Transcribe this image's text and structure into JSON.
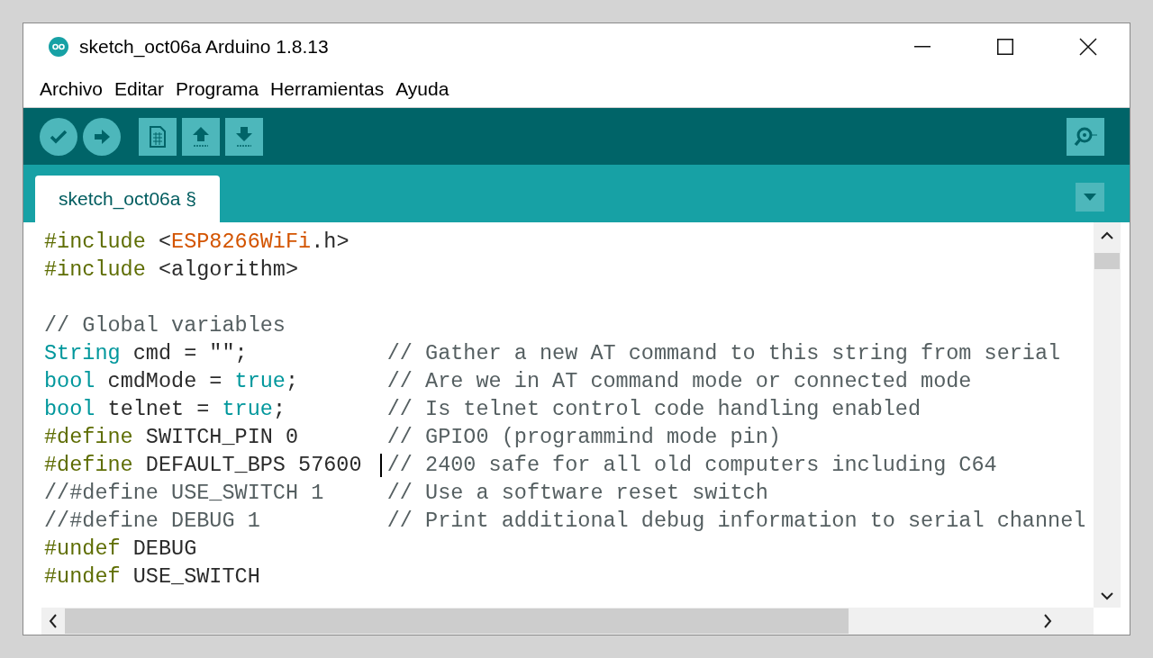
{
  "window": {
    "title": "sketch_oct06a Arduino 1.8.13"
  },
  "menu": [
    "Archivo",
    "Editar",
    "Programa",
    "Herramientas",
    "Ayuda"
  ],
  "tabs": [
    {
      "label": "sketch_oct06a §",
      "selected": true
    }
  ],
  "code_lines": [
    {
      "tokens": [
        {
          "kind": "directive",
          "text": "#include"
        },
        {
          "kind": "plain",
          "text": " <"
        },
        {
          "kind": "library",
          "text": "ESP8266WiFi"
        },
        {
          "kind": "plain",
          "text": ".h>"
        }
      ],
      "caret": false
    },
    {
      "tokens": [
        {
          "kind": "directive",
          "text": "#include"
        },
        {
          "kind": "plain",
          "text": " <algorithm>"
        }
      ],
      "caret": false
    },
    {
      "caret": false
    },
    {
      "tokens": [
        {
          "kind": "comment",
          "text": "// Global variables"
        }
      ],
      "caret": false
    },
    {
      "tokens": [
        {
          "kind": "type",
          "text": "String"
        },
        {
          "kind": "plain",
          "text": " cmd = \"\";"
        }
      ],
      "comment": "// Gather a new AT command to this string from serial",
      "caret": false
    },
    {
      "tokens": [
        {
          "kind": "type",
          "text": "bool"
        },
        {
          "kind": "plain",
          "text": " cmdMode = "
        },
        {
          "kind": "type",
          "text": "true"
        },
        {
          "kind": "plain",
          "text": ";"
        }
      ],
      "comment": "// Are we in AT command mode or connected mode",
      "caret": false
    },
    {
      "tokens": [
        {
          "kind": "type",
          "text": "bool"
        },
        {
          "kind": "plain",
          "text": " telnet = "
        },
        {
          "kind": "type",
          "text": "true"
        },
        {
          "kind": "plain",
          "text": ";"
        }
      ],
      "comment": "// Is telnet control code handling enabled",
      "caret": false
    },
    {
      "tokens": [
        {
          "kind": "directive",
          "text": "#define"
        },
        {
          "kind": "plain",
          "text": " SWITCH_PIN 0"
        }
      ],
      "comment": "// GPIO0 (programmind mode pin)",
      "caret": false
    },
    {
      "tokens": [
        {
          "kind": "directive",
          "text": "#define"
        },
        {
          "kind": "plain",
          "text": " DEFAULT_BPS 57600"
        }
      ],
      "comment": "// 2400 safe for all old computers including C64",
      "caret": true
    },
    {
      "tokens": [
        {
          "kind": "comment",
          "text": "//#define USE_SWITCH 1"
        }
      ],
      "comment": "// Use a software reset switch",
      "caret": false
    },
    {
      "tokens": [
        {
          "kind": "comment",
          "text": "//#define DEBUG 1"
        }
      ],
      "comment": "// Print additional debug information to serial channel",
      "caret": false
    },
    {
      "tokens": [
        {
          "kind": "directive",
          "text": "#undef"
        },
        {
          "kind": "plain",
          "text": " DEBUG"
        }
      ],
      "caret": false
    },
    {
      "tokens": [
        {
          "kind": "directive",
          "text": "#undef"
        },
        {
          "kind": "plain",
          "text": " USE_SWITCH"
        }
      ],
      "caret": false
    }
  ]
}
